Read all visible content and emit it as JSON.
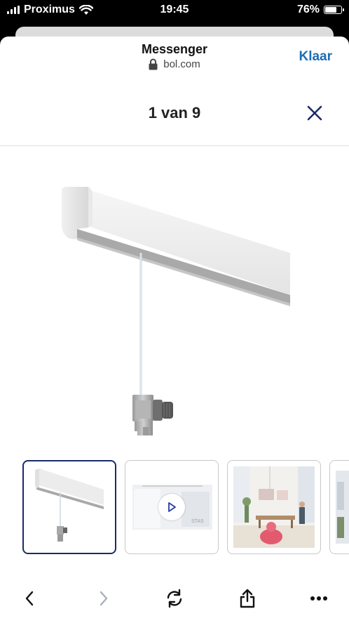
{
  "status": {
    "carrier": "Proximus",
    "time": "19:45",
    "battery": "76%",
    "battery_level": 0.76
  },
  "nav": {
    "title": "Messenger",
    "url": "bol.com",
    "done_label": "Klaar"
  },
  "gallery": {
    "counter": "1 van 9",
    "selected_index": 0
  },
  "thumbnails": [
    {
      "kind": "product-rail"
    },
    {
      "kind": "video",
      "watermark": "STAS"
    },
    {
      "kind": "room-photo"
    },
    {
      "kind": "partial"
    }
  ],
  "colors": {
    "accent": "#1d6db5",
    "selected_border": "#1b2a6b",
    "play_icon": "#2a3aa0"
  }
}
